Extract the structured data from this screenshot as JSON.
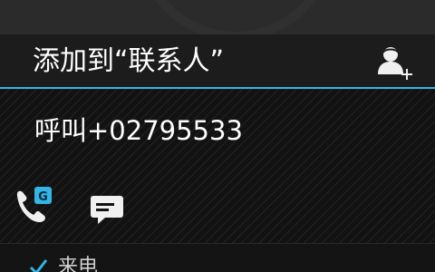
{
  "header": {
    "title": "添加到“联系人”",
    "add_contact_icon": "add-person-icon"
  },
  "detail": {
    "call_action": "呼叫+02795533",
    "phone_icon": "phone-icon",
    "google_badge": "G",
    "sms_icon": "message-icon"
  },
  "history": {
    "call_type_label": "来电",
    "call_type_icon": "incoming-call-icon"
  },
  "colors": {
    "accent": "#33b5e5",
    "background": "#000000",
    "header_background": "#1c1c1c",
    "text": "#ffffff"
  }
}
